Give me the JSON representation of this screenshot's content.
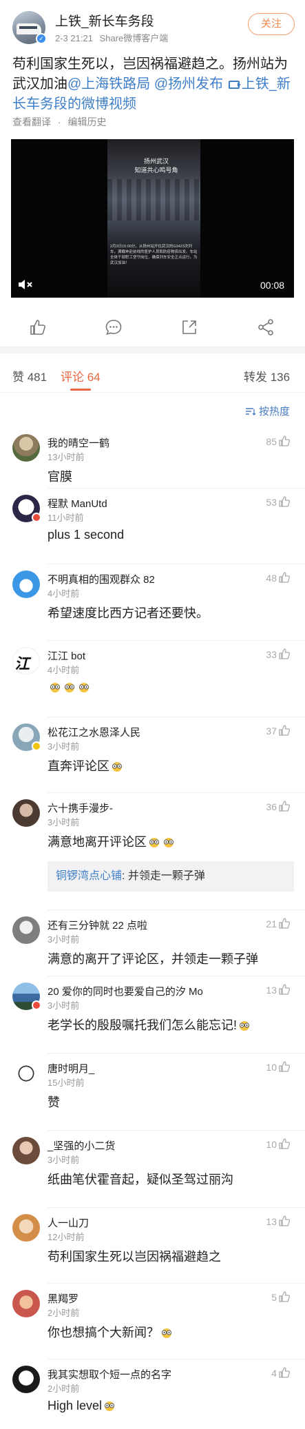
{
  "post": {
    "author": "上铁_新长车务段",
    "date": "2-3 21:21",
    "source": "Share微博客户端",
    "follow_label": "关注",
    "text_plain": "苟利国家生死以，岂因祸福避趋之。扬州站为武汉加油",
    "mention_1": "@上海铁路局",
    "mention_2": "@扬州发布",
    "video_link": "上铁_新长车务段的微博视频",
    "translate_label": "查看翻译",
    "edit_history_label": "编辑历史"
  },
  "video": {
    "title_line1": "扬州武汉",
    "title_line2": "知道共心鸣号角",
    "caption": "2月3日15:00分，从扬州站开往武汉的G3423次列车，满载奔赴前线的医护人员和防疫物资出发。车站全体干部职工坚守岗位，确保列车安全正点运行，为武汉加油！",
    "duration": "00:08"
  },
  "icons": {
    "actions": [
      "like-icon",
      "comment-icon",
      "share-icon",
      "forward-icon"
    ],
    "mute": "mute-icon",
    "sort": "sort-icon",
    "thumb": "thumb-up-icon"
  },
  "tabs": {
    "likes": "赞 481",
    "comments": "评论 64",
    "reposts": "转发 136",
    "sort_label": "按热度"
  },
  "comments": [
    {
      "name": "我的晴空一鹤",
      "time": "13小时前",
      "text": "官膜",
      "likes": "85"
    },
    {
      "name": "程默 ManUtd",
      "time": "11小时前",
      "text": "plus 1 second",
      "likes": "53"
    },
    {
      "name": "不明真相的围观群众 82",
      "time": "4小时前",
      "text": "希望速度比西方记者还要快。",
      "likes": "48"
    },
    {
      "name": "江江 bot",
      "time": "4小时前",
      "text": "",
      "likes": "33"
    },
    {
      "name": "松花江之水恩泽人民",
      "time": "3小时前",
      "text": "直奔评论区",
      "likes": "37"
    },
    {
      "name": "六十携手漫步-",
      "time": "3小时前",
      "text": "满意地离开评论区",
      "likes": "36",
      "reply_name": "铜锣湾点心铺",
      "reply_text": ": 并领走一颗子弹"
    },
    {
      "name": "还有三分钟就 22 点啦",
      "time": "3小时前",
      "text": "满意的离开了评论区，并领走一颗子弹",
      "likes": "21"
    },
    {
      "name": "20 爱你的同时也要爱自己的汐 Mo",
      "time": "3小时前",
      "text": "老学长的殷殷嘱托我们怎么能忘记!",
      "likes": "13"
    },
    {
      "name": "唐时明月_",
      "time": "15小时前",
      "text": "赞",
      "likes": "10"
    },
    {
      "name": "_坚强的小二货",
      "time": "3小时前",
      "text": "纸曲笔伏霍音起，疑似圣驾过丽沟",
      "likes": "10"
    },
    {
      "name": "人一山刀",
      "time": "12小时前",
      "text": "苟利国家生死以岂因祸福避趋之",
      "likes": "13"
    },
    {
      "name": "黑羯罗",
      "time": "2小时前",
      "text": "你也想搞个大新闻？",
      "likes": "5"
    },
    {
      "name": "我其实想取个短一点的名字",
      "time": "2小时前",
      "text": "High level",
      "likes": "4"
    }
  ],
  "colors": {
    "accent": "#e8663d",
    "link": "#3f7fc8",
    "follow": "#f08b4a"
  }
}
